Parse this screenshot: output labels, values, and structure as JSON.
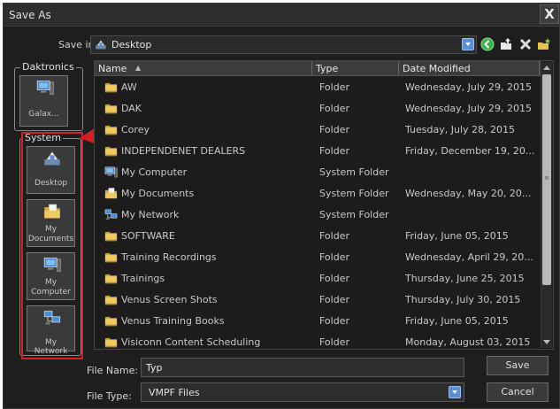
{
  "window": {
    "title": "Save As",
    "close_glyph": "X"
  },
  "save_in": {
    "label": "Save in:",
    "value": "Desktop",
    "icon": "desktop-icon"
  },
  "toolbar": [
    "back-icon",
    "up-folder-icon",
    "delete-icon",
    "new-folder-icon"
  ],
  "places": {
    "daktronics_group": "Daktronics",
    "galaxy_label": "Galax...",
    "system_group": "System",
    "desktop_label": "Desktop",
    "mydocs_label_1": "My",
    "mydocs_label_2": "Documents",
    "mycomp_label_1": "My",
    "mycomp_label_2": "Computer",
    "mynet_label": "My Network"
  },
  "columns": {
    "name": "Name",
    "type": "Type",
    "date": "Date Modified"
  },
  "files": [
    {
      "name": "AW",
      "type": "Folder",
      "date": "Wednesday, July 29, 2015",
      "icon": "folder-icon"
    },
    {
      "name": "DAK",
      "type": "Folder",
      "date": "Wednesday, July 29, 2015",
      "icon": "folder-icon"
    },
    {
      "name": "Corey",
      "type": "Folder",
      "date": "Tuesday, July 28, 2015",
      "icon": "folder-icon"
    },
    {
      "name": "INDEPENDENET DEALERS",
      "type": "Folder",
      "date": "Friday, December 19, 20...",
      "icon": "folder-icon"
    },
    {
      "name": "My Computer",
      "type": "System Folder",
      "date": "",
      "icon": "computer-icon"
    },
    {
      "name": "My Documents",
      "type": "System Folder",
      "date": "Wednesday, May 20, 20...",
      "icon": "documents-icon"
    },
    {
      "name": "My Network",
      "type": "System Folder",
      "date": "",
      "icon": "network-icon"
    },
    {
      "name": "SOFTWARE",
      "type": "Folder",
      "date": "Friday, June 05, 2015",
      "icon": "folder-icon"
    },
    {
      "name": "Training Recordings",
      "type": "Folder",
      "date": "Wednesday, April 29, 20...",
      "icon": "folder-icon"
    },
    {
      "name": "Trainings",
      "type": "Folder",
      "date": "Thursday, June 25, 2015",
      "icon": "folder-icon"
    },
    {
      "name": "Venus Screen Shots",
      "type": "Folder",
      "date": "Thursday, July 30, 2015",
      "icon": "folder-icon"
    },
    {
      "name": "Venus Training Books",
      "type": "Folder",
      "date": "Friday, June 05, 2015",
      "icon": "folder-icon"
    },
    {
      "name": "Visiconn Content Scheduling",
      "type": "Folder",
      "date": "Monday, August 03, 2015",
      "icon": "folder-icon"
    }
  ],
  "form": {
    "file_name_label": "File Name:",
    "file_name_value": "Typ",
    "file_type_label": "File Type:",
    "file_type_value": "VMPF Files",
    "save_label": "Save",
    "cancel_label": "Cancel"
  },
  "colors": {
    "background": "#1e1e1e",
    "highlight": "#d42020",
    "folder": "#e8c060",
    "accent": "#5a8fd8"
  }
}
